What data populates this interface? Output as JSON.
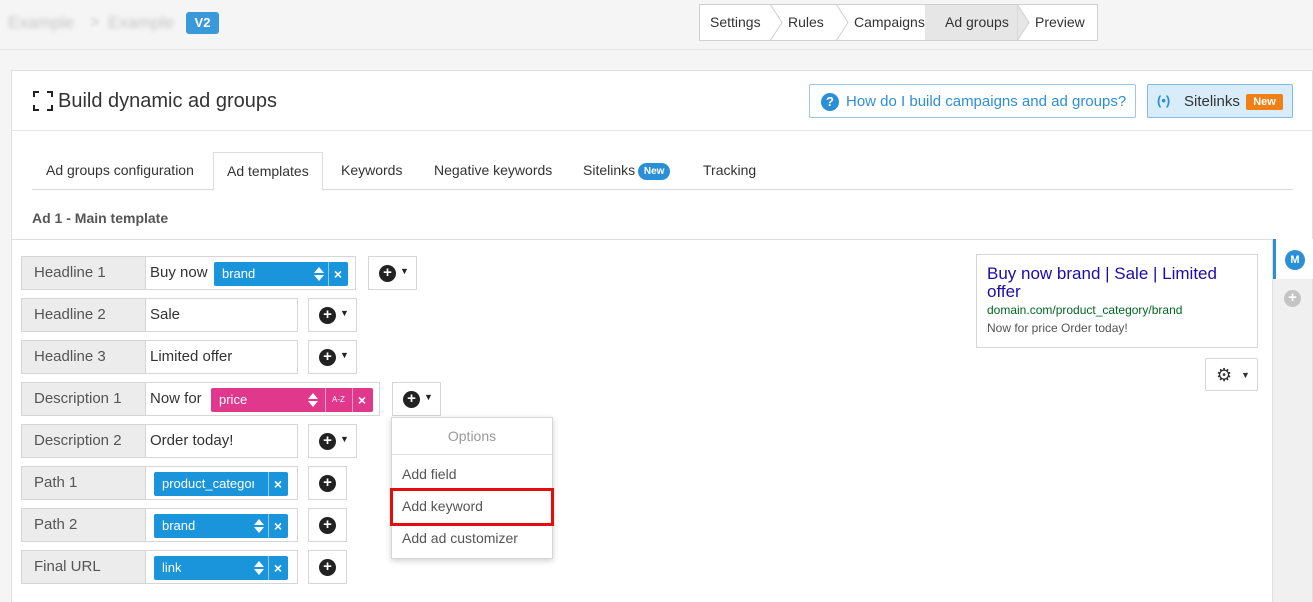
{
  "topbar": {
    "crumb1": "Example",
    "crumb_sep": ">",
    "crumb2": "Example",
    "version_badge": "V2",
    "steps": [
      "Settings",
      "Rules",
      "Campaigns",
      "Ad groups",
      "Preview"
    ],
    "active_step": "Ad groups"
  },
  "header": {
    "title": "Build dynamic ad groups",
    "help_label": "How do I build campaigns and ad groups?",
    "help_icon": "?",
    "sitelinks_icon": "(•)",
    "sitelinks_label": "Sitelinks",
    "sitelinks_badge": "New"
  },
  "tabs": [
    {
      "label": "Ad groups configuration"
    },
    {
      "label": "Ad templates"
    },
    {
      "label": "Keywords"
    },
    {
      "label": "Negative keywords"
    },
    {
      "label": "Sitelinks",
      "badge": "New"
    },
    {
      "label": "Tracking"
    }
  ],
  "active_tab": "Ad templates",
  "section_title": "Ad 1 - Main template",
  "rows": [
    {
      "label": "Headline 1",
      "text": "Buy now",
      "tag": "brand"
    },
    {
      "label": "Headline 2",
      "text": "Sale"
    },
    {
      "label": "Headline 3",
      "text": "Limited offer"
    },
    {
      "label": "Description 1",
      "text": "Now for",
      "tag": "price",
      "tag_modifier": "A-Z"
    },
    {
      "label": "Description 2",
      "text": "Order today!"
    },
    {
      "label": "Path 1",
      "tag": "product_category"
    },
    {
      "label": "Path 2",
      "tag": "brand"
    },
    {
      "label": "Final URL",
      "tag": "link"
    }
  ],
  "menu": {
    "header": "Options",
    "items": [
      "Add field",
      "Add keyword",
      "Add ad customizer"
    ],
    "highlighted": "Add keyword"
  },
  "preview": {
    "headline": "Buy now brand | Sale | Limited offer",
    "url": "domain.com/product_category/brand",
    "description": "Now for price Order today!"
  },
  "sidebar": {
    "active_marker": "M",
    "add_icon": "+"
  },
  "icons": {
    "add": "+",
    "caret": "▼",
    "remove": "×",
    "gear": "⚙"
  },
  "colors": {
    "accent": "#2b8fd8",
    "tag_blue": "#1a95dc",
    "tag_pink": "#e0388d",
    "badge_orange": "#f07f16",
    "highlight_red": "#e30d0d"
  }
}
